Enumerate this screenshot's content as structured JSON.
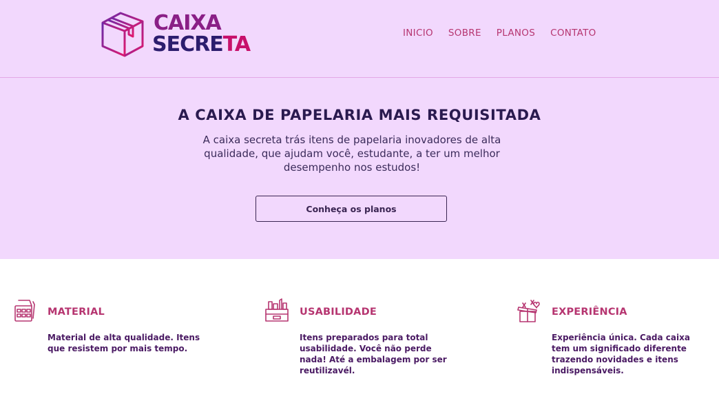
{
  "brand": {
    "line1": "CAIXA",
    "line2_part1": "SECRE",
    "line2_part2": "TA"
  },
  "nav": {
    "items": [
      "INICIO",
      "SOBRE",
      "PLANOS",
      "CONTATO"
    ]
  },
  "hero": {
    "title": "A CAIXA DE PAPELARIA MAIS REQUISITADA",
    "description": "A caixa secreta trás itens de papelaria inovadores de alta qualidade, que ajudam você, estudante, a ter um melhor desempenho nos estudos!",
    "button_label": "Conheça os planos"
  },
  "features": [
    {
      "icon": "stationery-icon",
      "title": "MATERIAL",
      "description": "Material de alta qualidade. Itens que resistem por mais tempo."
    },
    {
      "icon": "desk-organizer-icon",
      "title": "USABILIDADE",
      "description": "Itens preparados para total usabilidade. Você não perde nada! Até a embalagem por ser reutilizavél."
    },
    {
      "icon": "gift-box-icon",
      "title": "EXPERIÊNCIA",
      "description": "Experiência única. Cada caixa tem um significado diferente trazendo novidades e itens indispensáveis."
    }
  ],
  "colors": {
    "background_lilac": "#f2d8fd",
    "accent_pink": "#b63570",
    "dark_purple": "#2a1a4f"
  }
}
